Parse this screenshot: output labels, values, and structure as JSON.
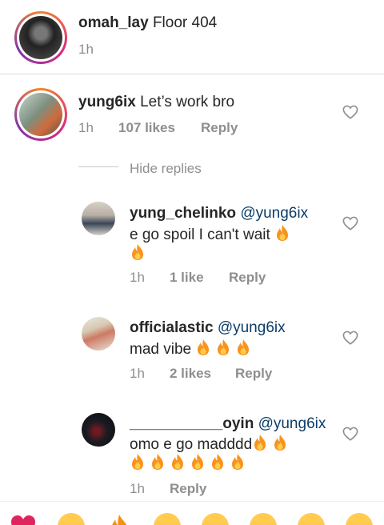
{
  "caption": {
    "username": "omah_lay",
    "text": "Floor 404",
    "time": "1h"
  },
  "comments": [
    {
      "username": "yung6ix",
      "text": "Let’s work bro",
      "time": "1h",
      "likes": "107 likes",
      "reply": "Reply"
    }
  ],
  "hide_replies": "Hide replies",
  "replies": [
    {
      "username": "yung_chelinko",
      "mention": "@yung6ix",
      "text": "e go spoil I can't wait",
      "fire_inline": 1,
      "fire_next": 1,
      "time": "1h",
      "likes": "1 like",
      "reply": "Reply"
    },
    {
      "username": "officialastic",
      "mention": "@yung6ix",
      "text": "mad vibe",
      "fire_inline": 3,
      "time": "1h",
      "likes": "2 likes",
      "reply": "Reply"
    },
    {
      "username": "___________oyin",
      "mention": "@yung6ix",
      "text": "omo e go madddd",
      "fire_inline": 2,
      "fire_next": 6,
      "time": "1h",
      "reply": "Reply"
    }
  ],
  "icons": {
    "like": "heart-outline-icon",
    "fire": "fire-emoji-icon"
  },
  "emoji_bar": [
    "red-heart",
    "raising-hands",
    "fire",
    "clapping-hands",
    "crying-laughing-face",
    "heart-eyes-face",
    "astonished-face",
    "grinning-face"
  ]
}
